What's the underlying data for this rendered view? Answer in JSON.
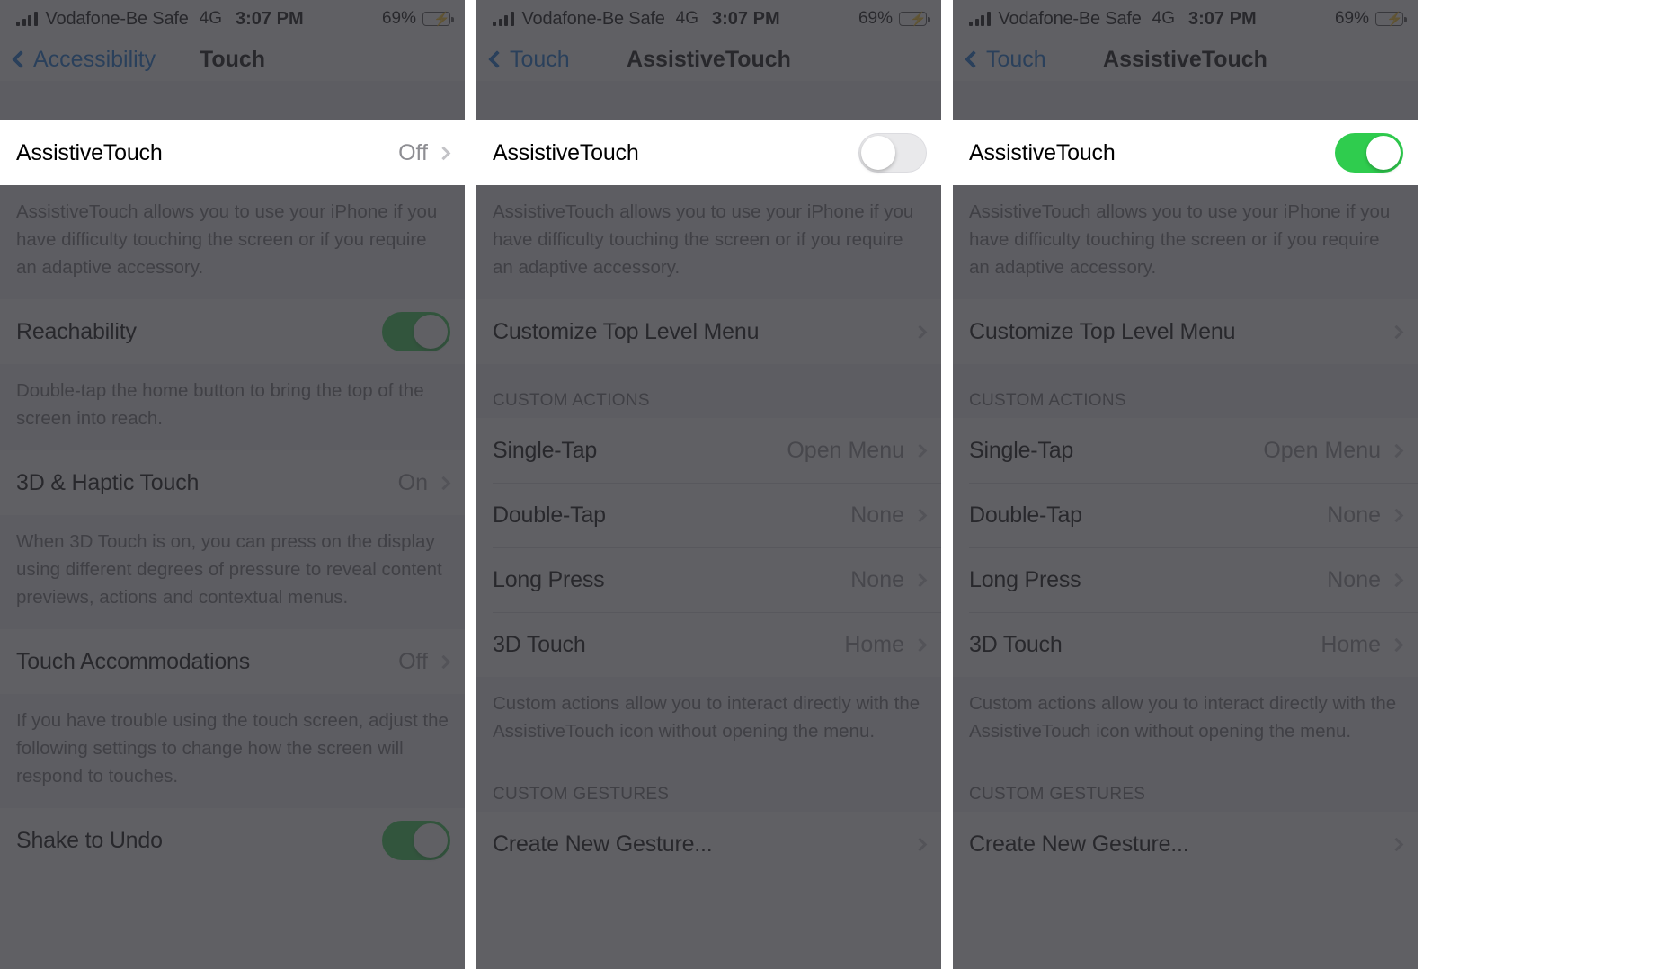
{
  "status_bar": {
    "signal_icon": "cellular-bars-icon",
    "carrier": "Vodafone-Be Safe",
    "network": "4G",
    "time": "3:07 PM",
    "battery_percent": "69%",
    "battery_icon": "battery-charging-icon",
    "battery_color": "#36c13f"
  },
  "panels": [
    {
      "nav": {
        "back_label": "Accessibility",
        "title": "Touch",
        "back_icon": "chevron-left-icon"
      },
      "highlight_row": {
        "label": "AssistiveTouch",
        "value": "Off",
        "accessory": "chevron-right-icon"
      },
      "note_1": "AssistiveTouch allows you to use your iPhone if you have difficulty touching the screen or if you require an adaptive accessory.",
      "rows": [
        {
          "label": "Reachability",
          "control": "toggle",
          "state": "on"
        },
        {
          "label": "3D & Haptic Touch",
          "value": "On",
          "accessory": "chevron-right-icon"
        },
        {
          "label": "Touch Accommodations",
          "value": "Off",
          "accessory": "chevron-right-icon"
        },
        {
          "label": "Shake to Undo",
          "control": "toggle",
          "state": "on"
        }
      ],
      "note_2": "Double-tap the home button to bring the top of the screen into reach.",
      "note_3": "When 3D Touch is on, you can press on the display using different degrees of pressure to reveal content previews, actions and contextual menus.",
      "note_4": "If you have trouble using the touch screen, adjust the following settings to change how the screen will respond to touches."
    },
    {
      "nav": {
        "back_label": "Touch",
        "title": "AssistiveTouch",
        "back_icon": "chevron-left-icon"
      },
      "highlight_row": {
        "label": "AssistiveTouch",
        "control": "toggle",
        "state": "off"
      },
      "note_1": "AssistiveTouch allows you to use your iPhone if you have difficulty touching the screen or if you require an adaptive accessory.",
      "customize_row": {
        "label": "Customize Top Level Menu",
        "accessory": "chevron-right-icon"
      },
      "custom_actions_header": "CUSTOM ACTIONS",
      "custom_actions": [
        {
          "label": "Single-Tap",
          "value": "Open Menu",
          "accessory": "chevron-right-icon"
        },
        {
          "label": "Double-Tap",
          "value": "None",
          "accessory": "chevron-right-icon"
        },
        {
          "label": "Long Press",
          "value": "None",
          "accessory": "chevron-right-icon"
        },
        {
          "label": "3D Touch",
          "value": "Home",
          "accessory": "chevron-right-icon"
        }
      ],
      "note_2": "Custom actions allow you to interact directly with the AssistiveTouch icon without opening the menu.",
      "custom_gestures_header": "CUSTOM GESTURES",
      "gesture_row": {
        "label": "Create New Gesture...",
        "accessory": "chevron-right-icon"
      }
    },
    {
      "nav": {
        "back_label": "Touch",
        "title": "AssistiveTouch",
        "back_icon": "chevron-left-icon"
      },
      "highlight_row": {
        "label": "AssistiveTouch",
        "control": "toggle",
        "state": "on"
      },
      "note_1": "AssistiveTouch allows you to use your iPhone if you have difficulty touching the screen or if you require an adaptive accessory.",
      "customize_row": {
        "label": "Customize Top Level Menu",
        "accessory": "chevron-right-icon"
      },
      "custom_actions_header": "CUSTOM ACTIONS",
      "custom_actions": [
        {
          "label": "Single-Tap",
          "value": "Open Menu",
          "accessory": "chevron-right-icon"
        },
        {
          "label": "Double-Tap",
          "value": "None",
          "accessory": "chevron-right-icon"
        },
        {
          "label": "Long Press",
          "value": "None",
          "accessory": "chevron-right-icon"
        },
        {
          "label": "3D Touch",
          "value": "Home",
          "accessory": "chevron-right-icon"
        }
      ],
      "note_2": "Custom actions allow you to interact directly with the AssistiveTouch icon without opening the menu.",
      "custom_gestures_header": "CUSTOM GESTURES",
      "gesture_row": {
        "label": "Create New Gesture...",
        "accessory": "chevron-right-icon"
      }
    }
  ]
}
